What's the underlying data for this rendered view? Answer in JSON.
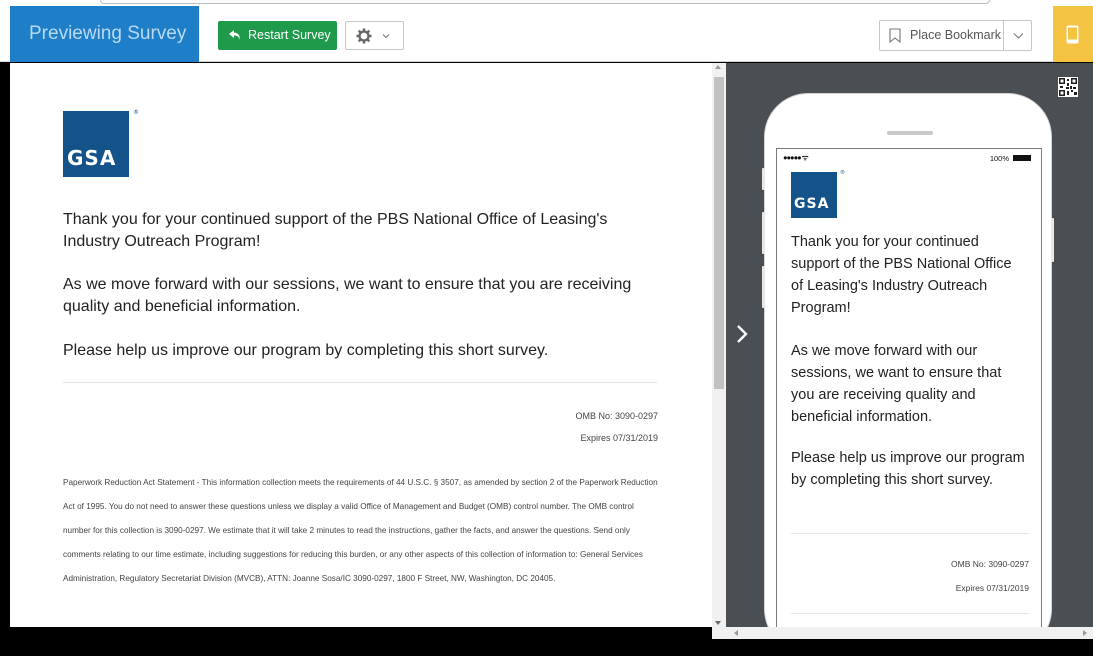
{
  "header": {
    "brand_title": "Previewing Survey",
    "restart_label": "Restart Survey",
    "bookmark_label": "Place Bookmark",
    "colors": {
      "brand": "#1e7ec8",
      "restart": "#1f9a4b",
      "mobile_toggle": "#f5c342"
    }
  },
  "survey": {
    "logo_text": "GSA",
    "logo_mark": "®",
    "intro_1": "Thank you for your continued support of the PBS National Office of Leasing's Industry Outreach Program!",
    "intro_2": "As we move forward with our sessions, we want to ensure that you are receiving quality and beneficial information.",
    "intro_3": "Please help us improve our program by completing this short survey.",
    "omb_number": "OMB No: 3090-0297",
    "expires": "Expires 07/31/2019",
    "paperwork_statement": "Paperwork Reduction Act Statement - This information collection meets the requirements of 44 U.S.C. § 3507, as amended by section 2 of the Paperwork Reduction Act of 1995. You do not need to answer these questions unless we display a valid Office of Management and Budget (OMB) control number. The OMB control number for this collection is 3090-0297. We estimate that it will take 2 minutes to read the instructions, gather the facts, and answer the questions. Send only comments relating to our time estimate, including suggestions for reducing this burden, or any other aspects of this collection of information to: General Services Administration, Regulatory Secretariat Division (MVCB), ATTN: Joanne Sosa/IC 3090-0297, 1800 F Street, NW, Washington, DC 20405."
  },
  "mobile": {
    "status_signal": "●●●●● ᯤ",
    "status_battery": "100%"
  },
  "icons": [
    "restart-icon",
    "gear-icon",
    "chevron-down-icon",
    "bookmark-icon",
    "mobile-device-icon",
    "qr-code-icon",
    "chevron-right-icon"
  ]
}
